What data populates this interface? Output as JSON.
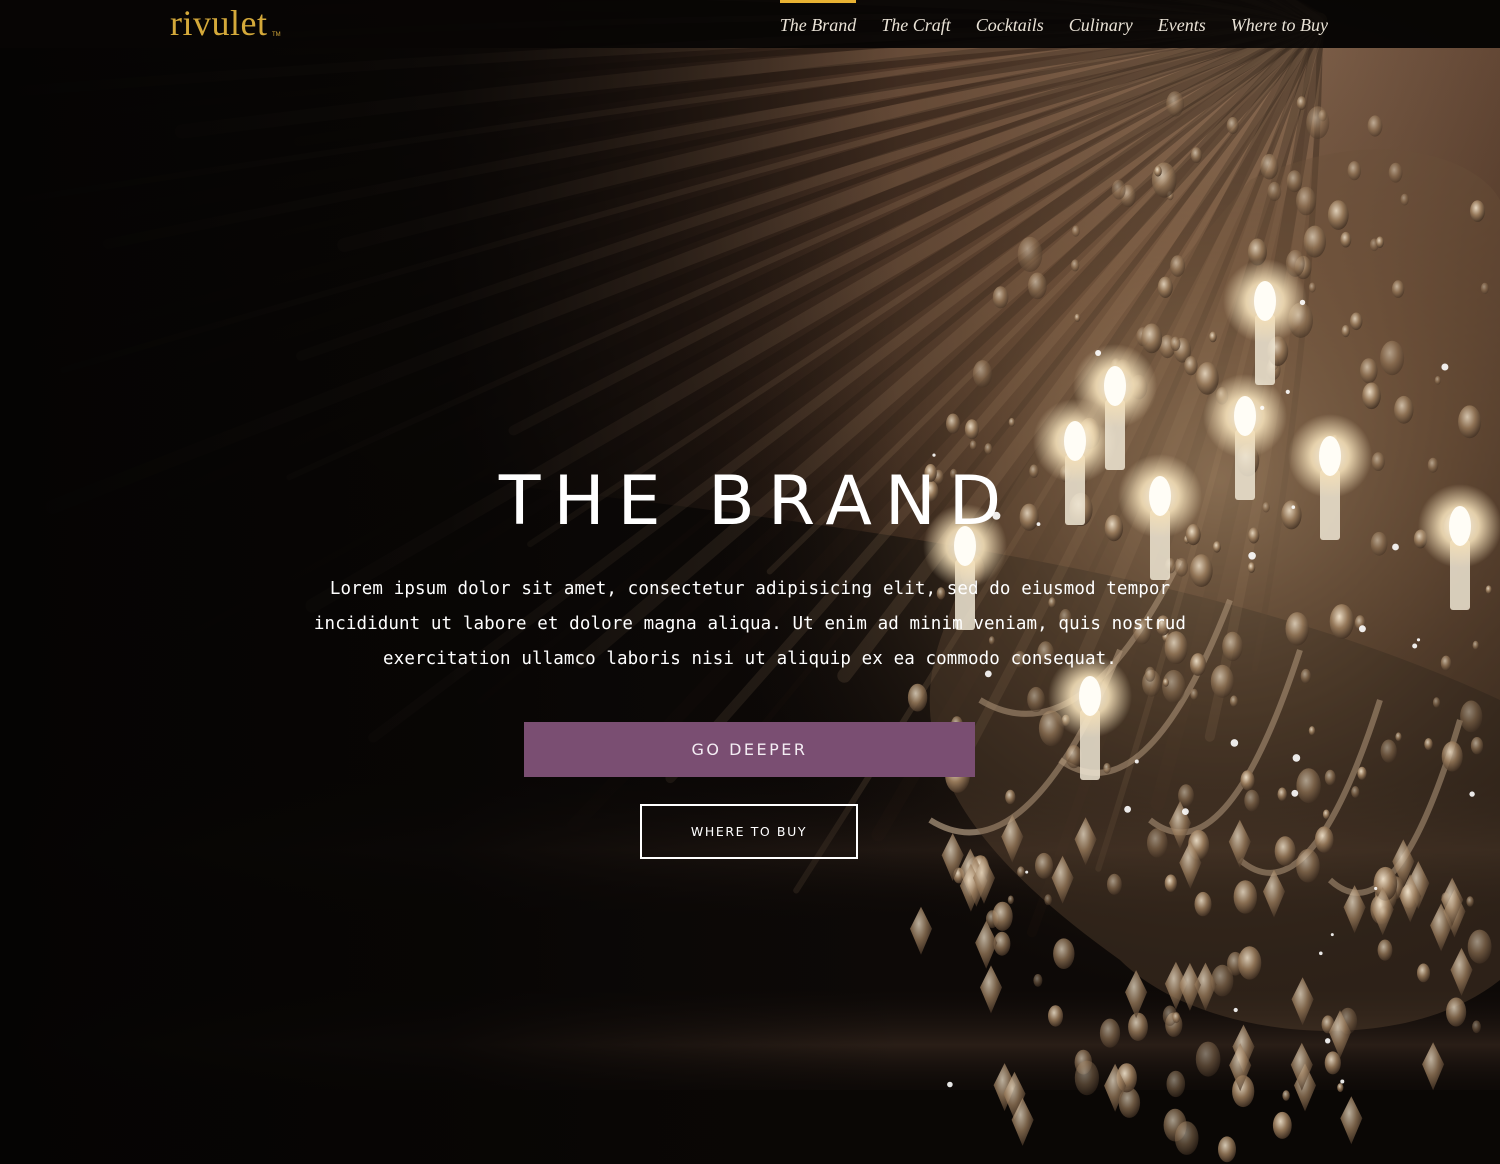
{
  "colors": {
    "accent": "#e8b233",
    "logo": "#d4a93a",
    "nav_text": "#e9e2d6",
    "hero_text": "#ffffff",
    "primary_button_bg": "#7a4e72",
    "primary_button_text": "#f3ecf3",
    "secondary_button_border": "#ffffff"
  },
  "header": {
    "logo": "rivulet",
    "logo_mark": "TM",
    "nav": [
      {
        "label": "The Brand",
        "active": true
      },
      {
        "label": "The Craft",
        "active": false
      },
      {
        "label": "Cocktails",
        "active": false
      },
      {
        "label": "Culinary",
        "active": false
      },
      {
        "label": "Events",
        "active": false
      },
      {
        "label": "Where to Buy",
        "active": false
      }
    ]
  },
  "hero": {
    "title": "THE BRAND",
    "body": "Lorem ipsum dolor sit amet, consectetur adipisicing elit, sed do eiusmod tempor incididunt ut labore et dolore magna aliqua. Ut enim ad minim veniam, quis nostrud exercitation ullamco laboris nisi ut aliquip ex ea commodo consequat.",
    "primary_cta": "GO DEEPER",
    "secondary_cta": "WHERE TO BUY",
    "background": "chandelier-photo"
  }
}
